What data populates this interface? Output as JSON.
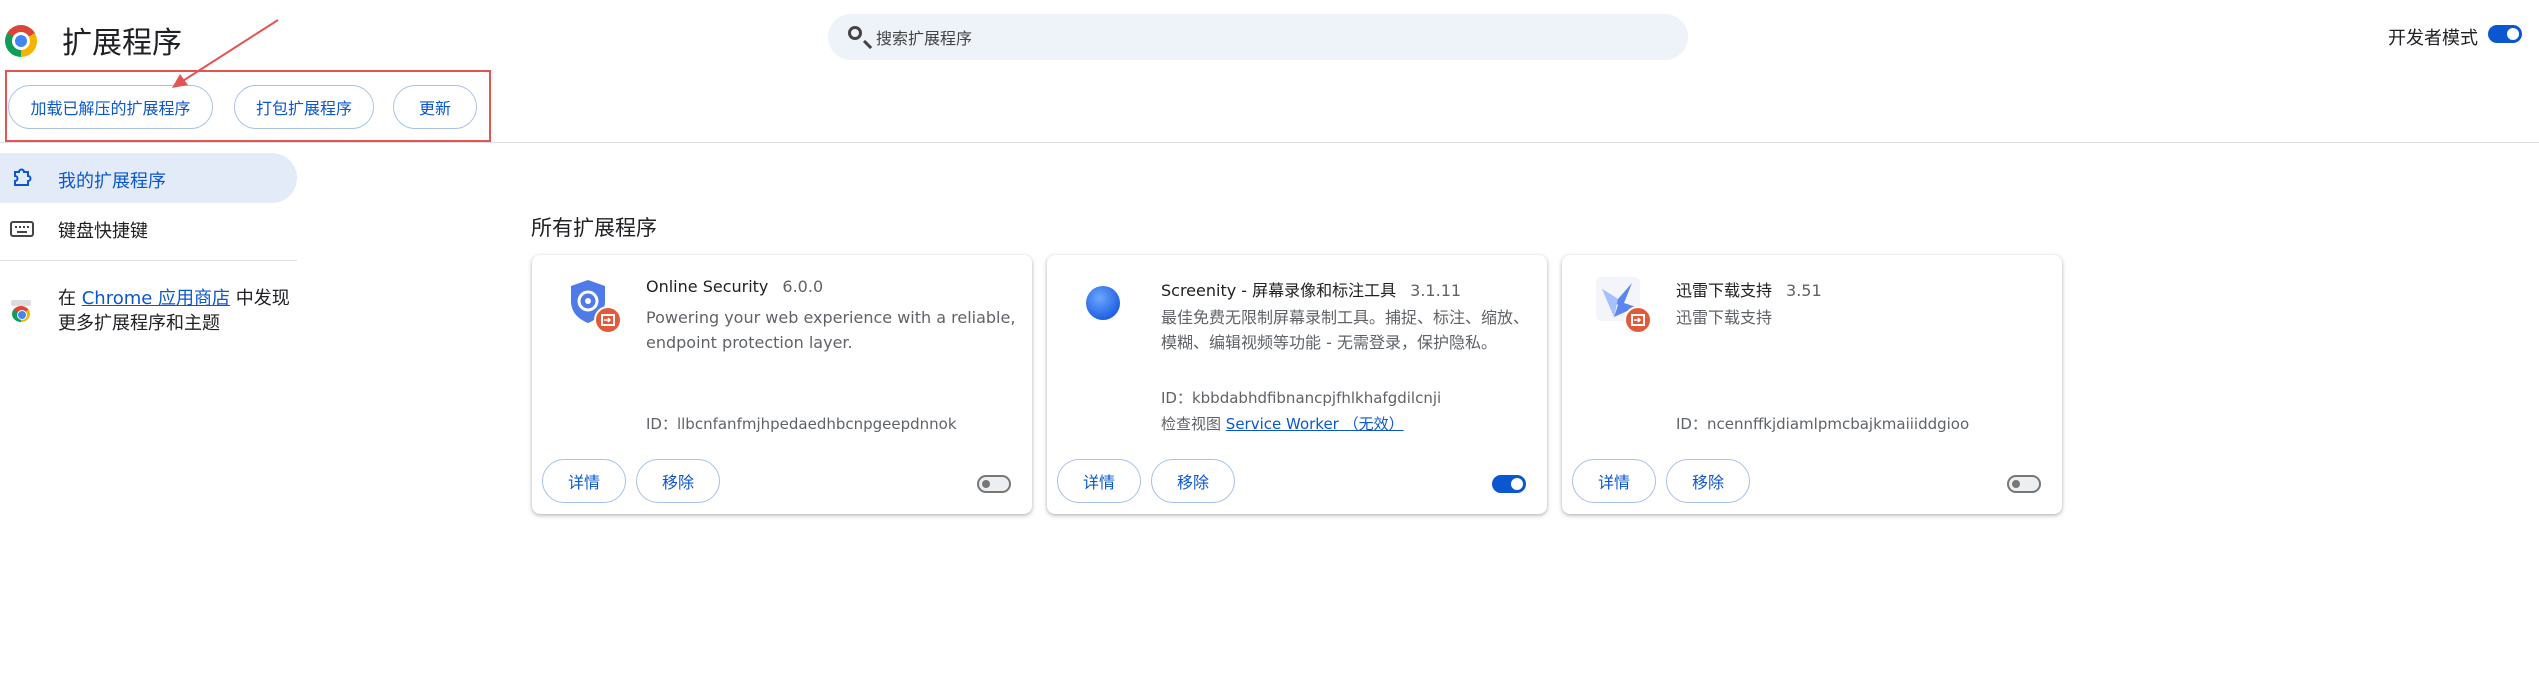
{
  "app": {
    "title": "扩展程序"
  },
  "search": {
    "placeholder": "搜索扩展程序"
  },
  "header": {
    "developer_mode_label": "开发者模式",
    "developer_mode_on": true
  },
  "toolbar": {
    "load_unpacked_label": "加载已解压的扩展程序",
    "pack_label": "打包扩展程序",
    "update_label": "更新"
  },
  "sidebar": {
    "items": [
      {
        "label": "我的扩展程序",
        "icon": "extension-icon",
        "active": true
      },
      {
        "label": "键盘快捷键",
        "icon": "keyboard-icon",
        "active": false
      }
    ],
    "promo": {
      "prefix": "在 ",
      "link": "Chrome 应用商店",
      "suffix": " 中发现更多扩展程序和主题",
      "icon": "chrome-web-store-icon"
    }
  },
  "main": {
    "section_title": "所有扩展程序"
  },
  "extensions": [
    {
      "name": "Online Security",
      "version": "6.0.0",
      "description": "Powering your web experience with a reliable, endpoint protection layer.",
      "id_label": "ID：llbcnfanfmjhpedaedhbcnpgeepdnnok",
      "details_label": "详情",
      "remove_label": "移除",
      "enabled": false,
      "icon": "shield-icon"
    },
    {
      "name": "Screenity - 屏幕录像和标注工具",
      "version": "3.1.11",
      "description": "最佳免费无限制屏幕录制工具。捕捉、标注、缩放、模糊、编辑视频等功能 - 无需登录，保护隐私。",
      "id_label": "ID：kbbdabhdfibnancpjfhlkhafgdilcnji",
      "inspect_label": "检查视图",
      "inspect_link": "Service Worker （无效）",
      "details_label": "详情",
      "remove_label": "移除",
      "enabled": true,
      "icon": "blue-circle-icon"
    },
    {
      "name": "迅雷下载支持",
      "version": "3.51",
      "description": "迅雷下载支持",
      "id_label": "ID：ncennffkjdiamlpmcbajkmaiiiddgioo",
      "details_label": "详情",
      "remove_label": "移除",
      "enabled": false,
      "icon": "thunder-bird-icon"
    }
  ],
  "colors": {
    "accent": "#0b57d0",
    "annotation": "#e25552",
    "active_nav": "#e3ebf9"
  }
}
